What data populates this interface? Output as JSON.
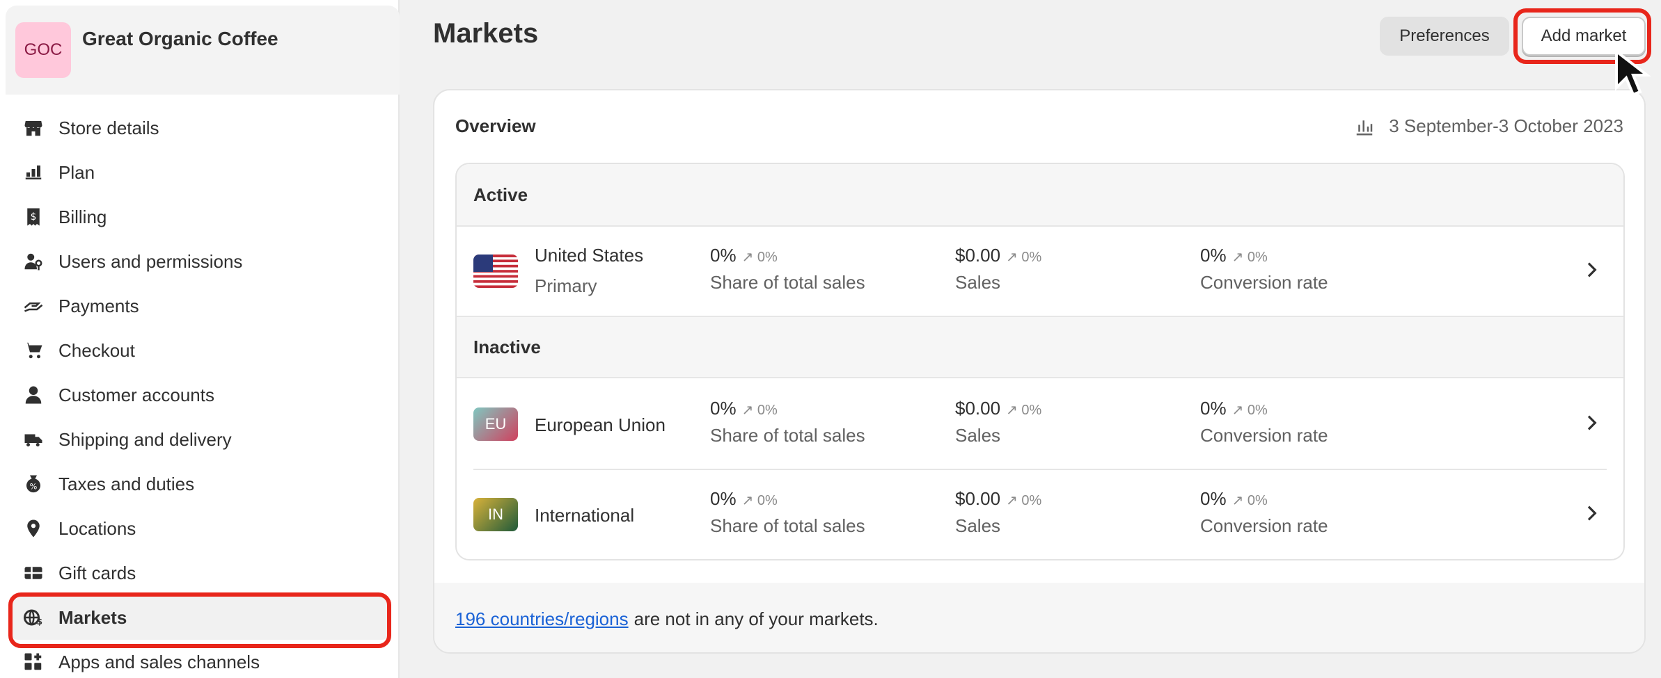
{
  "store": {
    "avatar_text": "GOC",
    "name": "Great Organic Coffee"
  },
  "sidebar": {
    "items": [
      {
        "label": "Store details",
        "icon": "store-icon"
      },
      {
        "label": "Plan",
        "icon": "plan-icon"
      },
      {
        "label": "Billing",
        "icon": "billing-icon"
      },
      {
        "label": "Users and permissions",
        "icon": "users-icon"
      },
      {
        "label": "Payments",
        "icon": "payments-icon"
      },
      {
        "label": "Checkout",
        "icon": "cart-icon"
      },
      {
        "label": "Customer accounts",
        "icon": "person-icon"
      },
      {
        "label": "Shipping and delivery",
        "icon": "truck-icon"
      },
      {
        "label": "Taxes and duties",
        "icon": "tax-icon"
      },
      {
        "label": "Locations",
        "icon": "location-icon"
      },
      {
        "label": "Gift cards",
        "icon": "gift-card-icon"
      },
      {
        "label": "Markets",
        "icon": "globe-dollar-icon"
      },
      {
        "label": "Apps and sales channels",
        "icon": "apps-icon"
      }
    ]
  },
  "header": {
    "title": "Markets",
    "preferences_label": "Preferences",
    "add_market_label": "Add market"
  },
  "overview": {
    "title": "Overview",
    "date_range": "3 September-3 October 2023",
    "active_label": "Active",
    "inactive_label": "Inactive",
    "markets": [
      {
        "name": "United States",
        "sub": "Primary",
        "flag": "US",
        "share": "0%",
        "share_chg": "0%",
        "share_label": "Share of total sales",
        "sales": "$0.00",
        "sales_chg": "0%",
        "sales_label": "Sales",
        "conv": "0%",
        "conv_chg": "0%",
        "conv_label": "Conversion rate"
      },
      {
        "name": "European Union",
        "sub": "",
        "flag": "EU",
        "share": "0%",
        "share_chg": "0%",
        "share_label": "Share of total sales",
        "sales": "$0.00",
        "sales_chg": "0%",
        "sales_label": "Sales",
        "conv": "0%",
        "conv_chg": "0%",
        "conv_label": "Conversion rate"
      },
      {
        "name": "International",
        "sub": "",
        "flag": "IN",
        "share": "0%",
        "share_chg": "0%",
        "share_label": "Share of total sales",
        "sales": "$0.00",
        "sales_chg": "0%",
        "sales_label": "Sales",
        "conv": "0%",
        "conv_chg": "0%",
        "conv_label": "Conversion rate"
      }
    ],
    "footer_link": "196 countries/regions",
    "footer_text": "are not in any of your markets."
  },
  "colors": {
    "highlight": "#e8261b",
    "link": "#1a62d6"
  }
}
